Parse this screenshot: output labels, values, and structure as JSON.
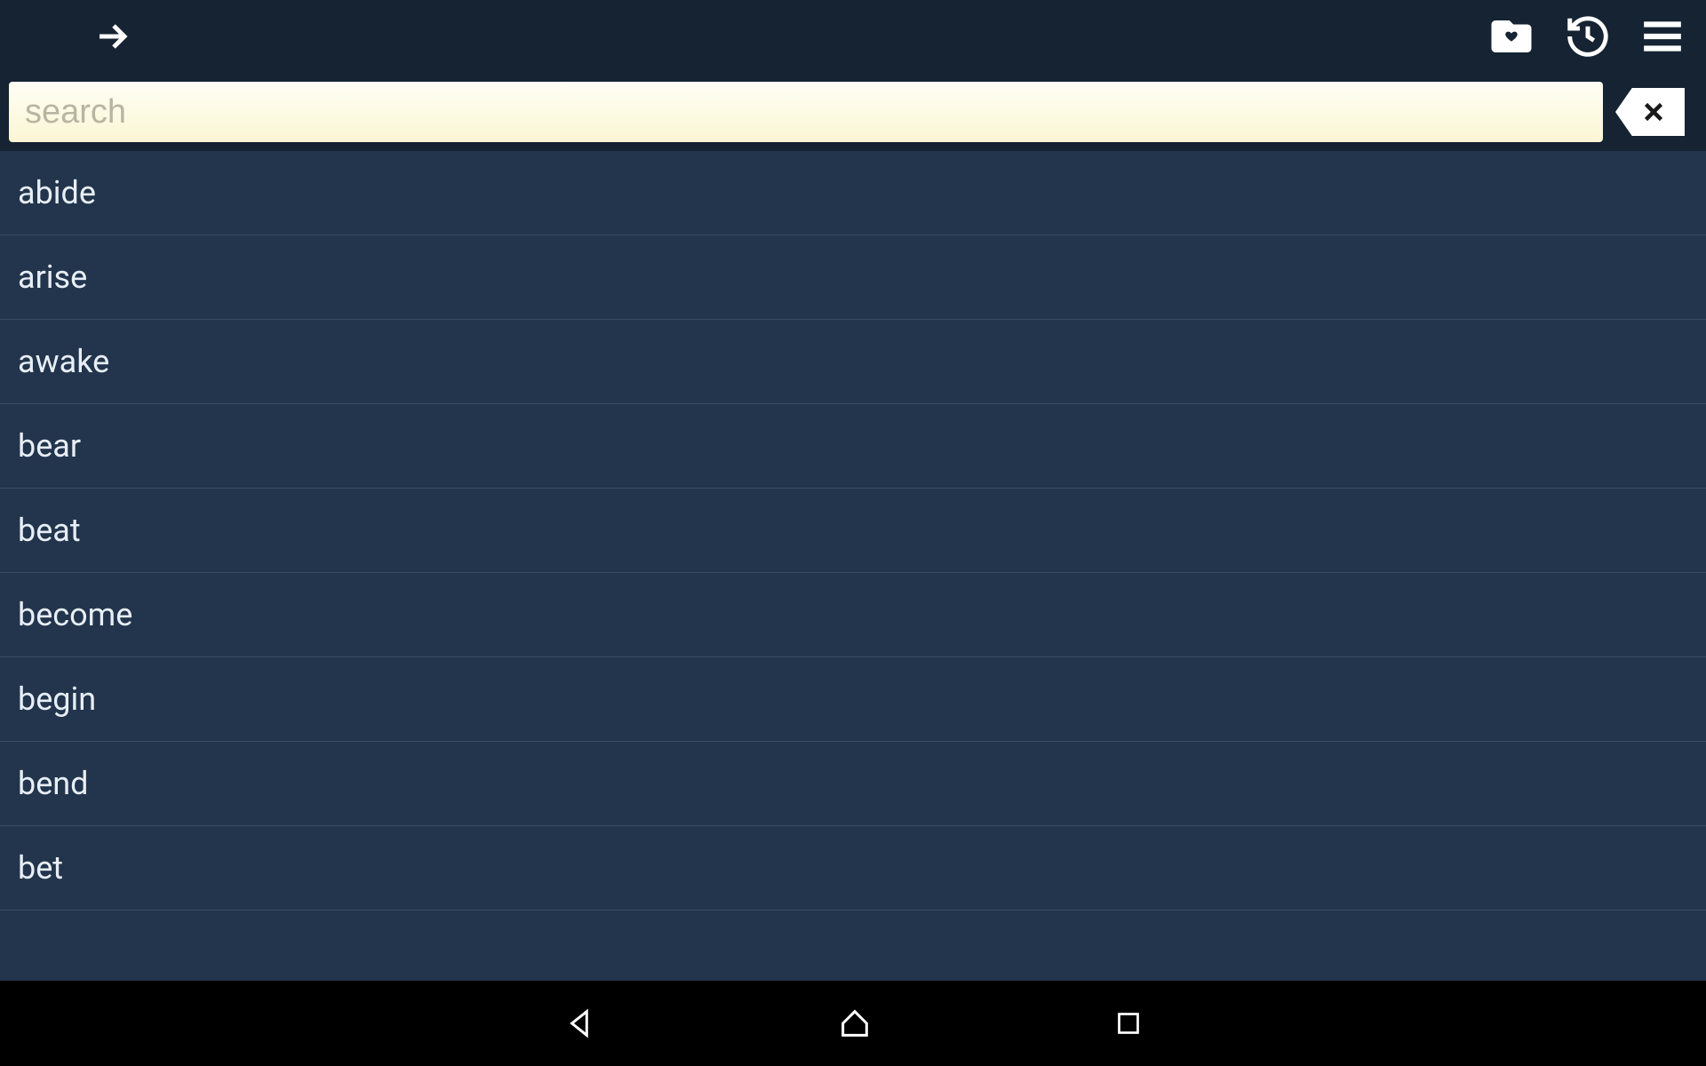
{
  "search": {
    "placeholder": "search",
    "value": ""
  },
  "words": [
    "abide",
    "arise",
    "awake",
    "bear",
    "beat",
    "become",
    "begin",
    "bend",
    "bet"
  ],
  "colors": {
    "bg": "#22354d",
    "topbar": "#152332",
    "searchbg": "#fdfae6",
    "text": "#e8eef5",
    "divider": "#3a4d63"
  }
}
